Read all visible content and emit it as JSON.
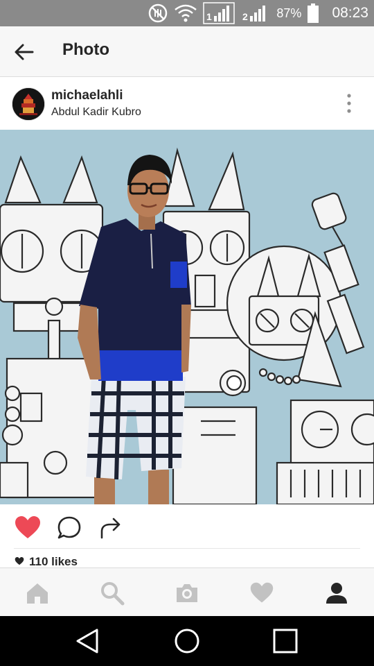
{
  "status_bar": {
    "battery": "87%",
    "time": "08:23",
    "sim1_label": "1",
    "sim2_label": "2",
    "icons": [
      "mute-icon",
      "wifi-icon",
      "signal-sim1-icon",
      "signal-sim2-icon",
      "battery-icon"
    ]
  },
  "app_bar": {
    "title": "Photo",
    "back_icon": "arrow-left-icon"
  },
  "post": {
    "username": "michaelahli",
    "location": "Abdul Kadir Kubro",
    "more_icon": "more-vertical-icon",
    "liked": true,
    "likes_text": "110 likes"
  },
  "actions": [
    "heart-icon",
    "comment-icon",
    "share-icon"
  ],
  "tab_bar": [
    "home-icon",
    "search-icon",
    "camera-icon",
    "activity-heart-icon",
    "profile-icon"
  ],
  "nav_bar": [
    "back-triangle-icon",
    "home-circle-icon",
    "recents-square-icon"
  ],
  "colors": {
    "status_bar": "#8a8a8a",
    "like_red": "#ed4956",
    "tab_inactive": "#c2c2c2",
    "tab_active": "#262626",
    "photo_background": "#a9c9d6",
    "shirt": "#1a1f44",
    "shirt_accent": "#1f3dc9"
  }
}
